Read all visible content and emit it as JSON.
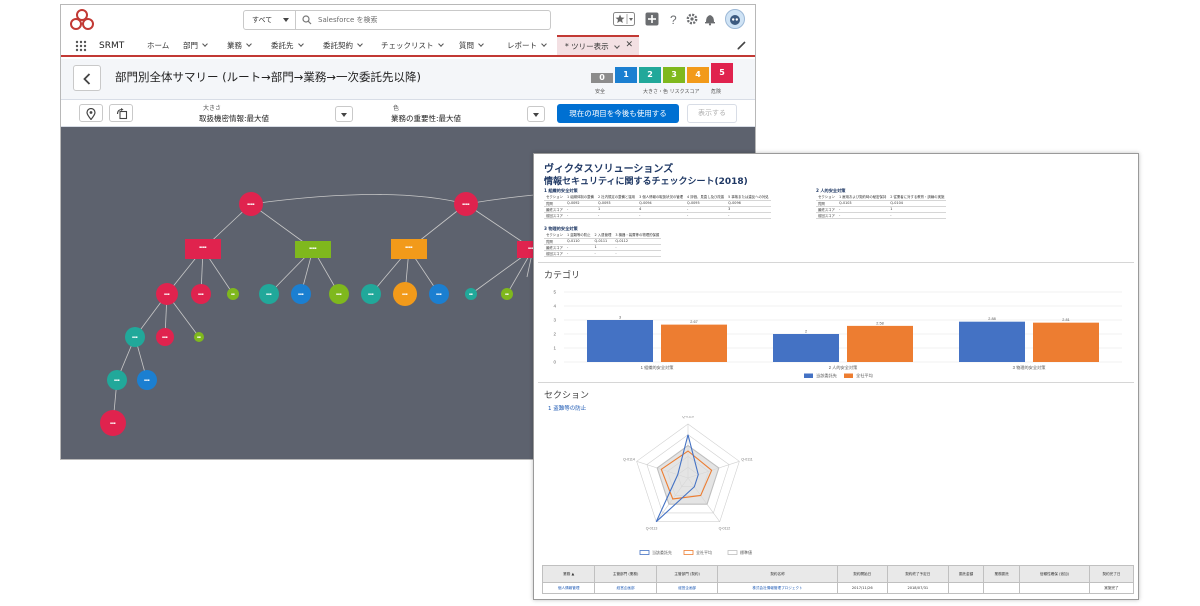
{
  "topbar": {
    "search_scope": "すべて",
    "search_placeholder": "Salesforce を検索"
  },
  "nav": {
    "app_name": "SRMT",
    "items": [
      {
        "label": "ホーム",
        "dropdown": false
      },
      {
        "label": "部門",
        "dropdown": true
      },
      {
        "label": "業務",
        "dropdown": true
      },
      {
        "label": "委託先",
        "dropdown": true
      },
      {
        "label": "委託契約",
        "dropdown": true
      },
      {
        "label": "チェックリスト",
        "dropdown": true
      },
      {
        "label": "質問",
        "dropdown": true
      },
      {
        "label": "レポート",
        "dropdown": true
      }
    ],
    "active_tab": "* ツリー表示"
  },
  "header": {
    "title": "部門別全体サマリー (ルート→部門→業務→一次委託先以降)"
  },
  "risk_scale": {
    "levels": [
      {
        "value": "0",
        "color": "#8c8c8c"
      },
      {
        "value": "1",
        "color": "#1b7fd1"
      },
      {
        "value": "2",
        "color": "#21a89a"
      },
      {
        "value": "3",
        "color": "#7fb81d"
      },
      {
        "value": "4",
        "color": "#f29a1a"
      },
      {
        "value": "5",
        "color": "#e0234e"
      }
    ],
    "label_safe": "安全",
    "label_middle": "大きさ・色 リスクスコア",
    "label_danger": "危険"
  },
  "toolbar": {
    "size_label": "大きさ",
    "size_value": "取扱機密情報:最大値",
    "color_label": "色",
    "color_value": "業務の重要性:最大値",
    "use_button": "現在の項目を今後も使用する",
    "display_button": "表示する"
  },
  "report": {
    "company": "ヴィクタスソリューションズ",
    "title": "情報セキュリティに関するチェックシート(2018)",
    "table1": {
      "caption": "1 組織的安全対策",
      "rows": [
        [
          "セクション",
          "1 組織体制の整備",
          "2 社内規定の整備と運用",
          "3 個人情報の取扱状況の管理",
          "4 評価、見直し及び改善",
          "5 事故または違反への対処"
        ],
        [
          "質問",
          "Q-0092",
          "Q-0093",
          "Q-0094",
          "Q-0095",
          "Q-0096"
        ],
        [
          "最終スコア",
          "-",
          "1",
          "4",
          "-",
          "3"
        ],
        [
          "前回スコア",
          "-",
          "-",
          "-",
          "-",
          "-"
        ]
      ]
    },
    "table2": {
      "caption": "2 人的安全対策",
      "rows": [
        [
          "セクション",
          "1 雇用および契約時の秘密保持",
          "2 従業者に対する教育・訓練の実施"
        ],
        [
          "質問",
          "Q-0103",
          "Q-0104"
        ],
        [
          "最終スコア",
          "-",
          "1"
        ],
        [
          "前回スコア",
          "-",
          "-"
        ]
      ]
    },
    "table3": {
      "caption": "3 物理的安全対策",
      "rows": [
        [
          "セクション",
          "1 盗難等の防止",
          "2 入退管理",
          "3 機器・装置等の物理的保護"
        ],
        [
          "質問",
          "Q-0110",
          "Q-0111",
          "Q-0112"
        ],
        [
          "最終スコア",
          "-",
          "1",
          "-"
        ],
        [
          "前回スコア",
          "-",
          "-",
          "-"
        ]
      ]
    },
    "category_heading": "カテゴリ",
    "section_heading": "セクション",
    "section_sub": "1 盗難等の防止",
    "bottom_table": {
      "headers": [
        "業務 ▲",
        "主管部門 (業務)",
        "主管部門 (契約)",
        "契約名称",
        "契約開始日",
        "契約終了予定日",
        "委託金額",
        "業務委託",
        "信頼性確保 (追加)",
        "契約完了日"
      ],
      "row": [
        "個人情報管理",
        "経営企画部",
        "経営企画部",
        "株式会社情報管理プロジェクト",
        "2017/11/26",
        "2018/07/31",
        "",
        "",
        "",
        "実施完了"
      ]
    }
  },
  "chart_data": [
    {
      "type": "bar",
      "title": "カテゴリ",
      "categories": [
        "1 組織的安全対策",
        "2 人的安全対策",
        "3 物理的安全対策"
      ],
      "series": [
        {
          "name": "当該委託先",
          "values": [
            3,
            2,
            2.88
          ],
          "color": "#4472c4"
        },
        {
          "name": "全社平均",
          "values": [
            2.67,
            2.58,
            2.81
          ],
          "color": "#ed7d31"
        }
      ],
      "ylim": [
        0,
        5
      ],
      "yticks": [
        0,
        1,
        2,
        3,
        4,
        5
      ],
      "value_labels": [
        "3",
        "2.67",
        "2",
        "2.58",
        "2.88",
        "2.81"
      ],
      "legend": "bottom"
    },
    {
      "type": "radar",
      "title": "セクション",
      "axes": [
        "Q-0110",
        "Q-0111",
        "Q-0112",
        "Q-0113",
        "Q-0114"
      ],
      "series": [
        {
          "name": "当該委託先",
          "values": [
            4,
            1,
            1,
            5,
            1
          ],
          "color": "#4472c4"
        },
        {
          "name": "全社平均",
          "values": [
            2.5,
            2.3,
            2.0,
            2.4,
            2.6
          ],
          "color": "#ed7d31"
        },
        {
          "name": "標準値",
          "values": [
            3,
            3,
            3,
            3,
            3
          ],
          "color": "#bfbfbf"
        }
      ],
      "rlim": [
        0,
        5
      ],
      "legend": "bottom"
    }
  ]
}
